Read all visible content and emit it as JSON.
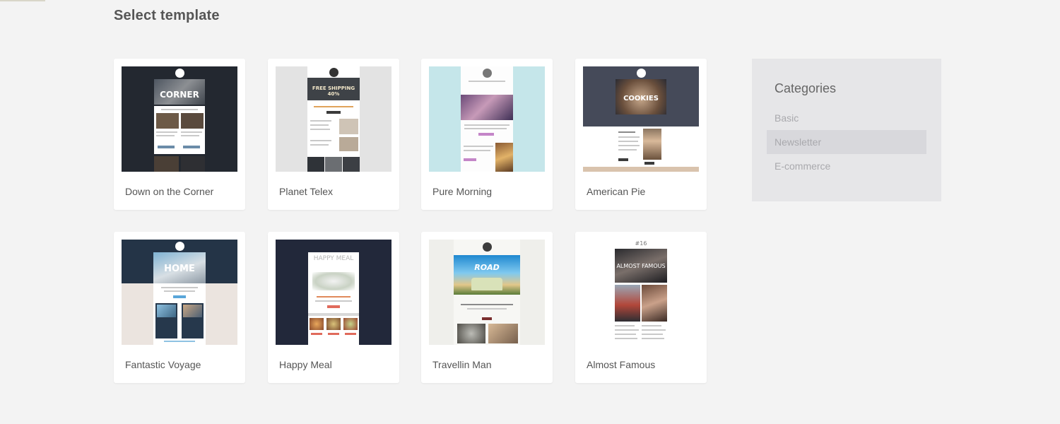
{
  "page": {
    "title": "Select template"
  },
  "templates": [
    {
      "name": "Down on the Corner",
      "hero_text": "CORNER"
    },
    {
      "name": "Planet Telex",
      "hero_text": "FREE SHIPPING 40%"
    },
    {
      "name": "Pure Morning"
    },
    {
      "name": "American Pie",
      "hero_text": "COOKIES"
    },
    {
      "name": "Fantastic Voyage",
      "hero_text": "HOME"
    },
    {
      "name": "Happy Meal",
      "hero_text": "HAPPY MEAL"
    },
    {
      "name": "Travellin Man",
      "hero_text": "ROAD"
    },
    {
      "name": "Almost Famous",
      "issue": "#16",
      "hero_text": "ALMOST FAMOUS"
    }
  ],
  "categories": {
    "title": "Categories",
    "items": [
      {
        "label": "Basic",
        "active": false
      },
      {
        "label": "Newsletter",
        "active": true
      },
      {
        "label": "E-commerce",
        "active": false
      }
    ]
  },
  "colors": {
    "background": "#f3f3f3",
    "card": "#ffffff",
    "panel": "#e6e6e8",
    "panel_active": "#d8d8dc"
  }
}
